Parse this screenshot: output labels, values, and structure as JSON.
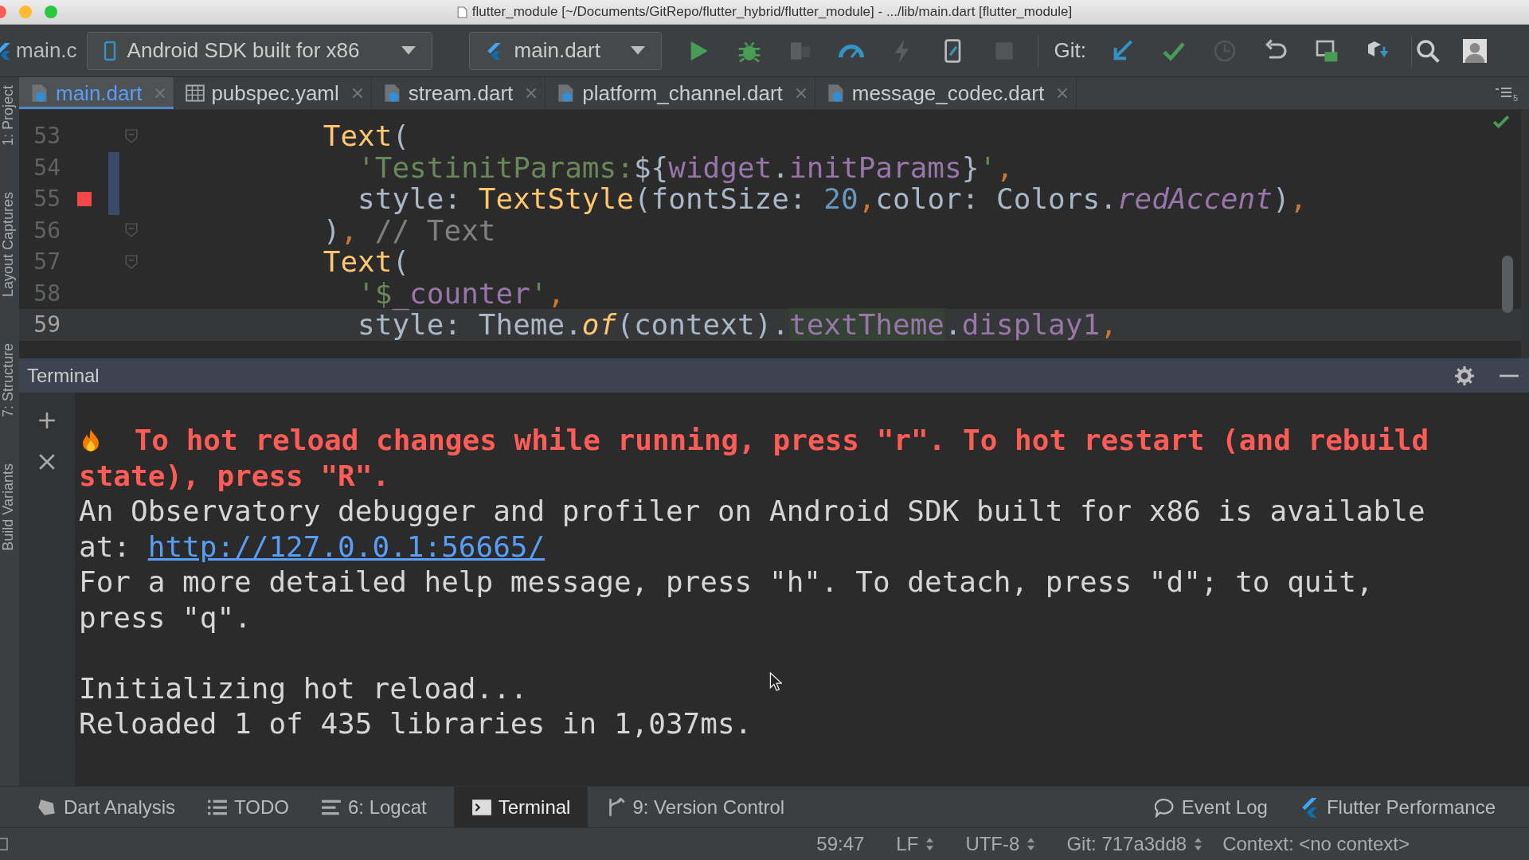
{
  "window": {
    "title": "flutter_module [~/Documents/GitRepo/flutter_hybrid/flutter_module] - .../lib/main.dart [flutter_module]"
  },
  "toolbar": {
    "project_tab": "main.c",
    "device": "Android SDK built for x86",
    "run_config": "main.dart",
    "actions": [
      {
        "kind": "run",
        "disabled": false
      },
      {
        "kind": "debug",
        "disabled": false
      },
      {
        "kind": "attach",
        "disabled": true
      },
      {
        "kind": "profile",
        "disabled": false
      },
      {
        "kind": "hot-reload",
        "disabled": true
      },
      {
        "kind": "device-file",
        "disabled": false
      },
      {
        "kind": "stop",
        "disabled": true
      }
    ],
    "git_label": "Git:",
    "git_actions": [
      {
        "kind": "update",
        "disabled": false
      },
      {
        "kind": "commit",
        "disabled": false
      },
      {
        "kind": "history",
        "disabled": true
      },
      {
        "kind": "revert",
        "disabled": false
      },
      {
        "kind": "screen",
        "disabled": false
      },
      {
        "kind": "boxes",
        "disabled": false
      }
    ]
  },
  "side_panels": [
    "1: Project",
    "Layout Captures",
    "7: Structure",
    "Build Variants"
  ],
  "editor_tabs": [
    {
      "label": "main.dart",
      "selected": true,
      "kind": "dart"
    },
    {
      "label": "pubspec.yaml",
      "selected": false,
      "kind": "yaml"
    },
    {
      "label": "stream.dart",
      "selected": false,
      "kind": "dart"
    },
    {
      "label": "platform_channel.dart",
      "selected": false,
      "kind": "dart"
    },
    {
      "label": "message_codec.dart",
      "selected": false,
      "kind": "dart"
    }
  ],
  "tab_overflow_count": "5",
  "code_lines": [
    {
      "number": "53",
      "breakpoint": false,
      "fold": true,
      "changed": false,
      "current": false,
      "tokens": [
        {
          "kind": "type",
          "text": "          Text"
        },
        {
          "kind": "plain",
          "text": "("
        }
      ]
    },
    {
      "number": "54",
      "breakpoint": false,
      "fold": false,
      "changed": true,
      "current": false,
      "tokens": [
        {
          "kind": "string",
          "text": "            'TestinitParams:"
        },
        {
          "kind": "plain",
          "text": "${"
        },
        {
          "kind": "field",
          "text": "widget"
        },
        {
          "kind": "plain",
          "text": "."
        },
        {
          "kind": "field",
          "text": "initParams"
        },
        {
          "kind": "plain",
          "text": "}"
        },
        {
          "kind": "string",
          "text": "'"
        },
        {
          "kind": "punct",
          "text": ","
        }
      ]
    },
    {
      "number": "55",
      "breakpoint": true,
      "fold": false,
      "changed": true,
      "current": false,
      "tokens": [
        {
          "kind": "plain",
          "text": "            style: "
        },
        {
          "kind": "type",
          "text": "TextStyle"
        },
        {
          "kind": "plain",
          "text": "(fontSize: "
        },
        {
          "kind": "number",
          "text": "20"
        },
        {
          "kind": "punct",
          "text": ","
        },
        {
          "kind": "plain",
          "text": "color: Colors."
        },
        {
          "kind": "static",
          "text": "redAccent"
        },
        {
          "kind": "plain",
          "text": ")"
        },
        {
          "kind": "punct",
          "text": ","
        }
      ]
    },
    {
      "number": "56",
      "breakpoint": false,
      "fold": true,
      "changed": false,
      "current": false,
      "tokens": [
        {
          "kind": "plain",
          "text": "          )"
        },
        {
          "kind": "punct",
          "text": ","
        },
        {
          "kind": "comment",
          "text": " // Text"
        }
      ]
    },
    {
      "number": "57",
      "breakpoint": false,
      "fold": true,
      "changed": false,
      "current": false,
      "tokens": [
        {
          "kind": "type",
          "text": "          Text"
        },
        {
          "kind": "plain",
          "text": "("
        }
      ]
    },
    {
      "number": "58",
      "breakpoint": false,
      "fold": false,
      "changed": false,
      "current": false,
      "tokens": [
        {
          "kind": "string",
          "text": "            '$"
        },
        {
          "kind": "field",
          "text": "_counter"
        },
        {
          "kind": "string",
          "text": "'"
        },
        {
          "kind": "punct",
          "text": ","
        }
      ]
    },
    {
      "number": "59",
      "breakpoint": false,
      "fold": false,
      "changed": false,
      "current": true,
      "tokens": [
        {
          "kind": "plain",
          "text": "            style: Theme."
        },
        {
          "kind": "method",
          "text": "of"
        },
        {
          "kind": "plain",
          "text": "(context)."
        },
        {
          "kind": "field-hl",
          "text": "textTheme"
        },
        {
          "kind": "plain",
          "text": "."
        },
        {
          "kind": "field",
          "text": "display1"
        },
        {
          "kind": "punct",
          "text": ","
        }
      ]
    }
  ],
  "terminal": {
    "title": "Terminal",
    "lines": [
      {
        "kind": "warning-start",
        "blank_line_before": false,
        "text": "To hot reload changes while running, press \"r\". To hot restart (and rebuild"
      },
      {
        "kind": "warning",
        "blank_line_before": false,
        "text": "state), press \"R\"."
      },
      {
        "kind": "info",
        "blank_line_before": false,
        "text": "An Observatory debugger and profiler on Android SDK built for x86 is available at: ",
        "link": "http://127.0.0.1:56665/"
      },
      {
        "kind": "info",
        "blank_line_before": false,
        "text": "For a more detailed help message, press \"h\". To detach, press \"d\"; to quit, press \"q\"."
      },
      {
        "kind": "info",
        "blank_line_before": true,
        "text": "Initializing hot reload..."
      },
      {
        "kind": "info",
        "blank_line_before": false,
        "text": "Reloaded 1 of 435 libraries in 1,037ms."
      }
    ]
  },
  "tool_windows_left": [
    {
      "label": "Dart Analysis",
      "kind": "dart",
      "selected": false
    },
    {
      "label": "TODO",
      "kind": "list",
      "selected": false
    },
    {
      "label": "6: Logcat",
      "kind": "lines",
      "selected": false
    },
    {
      "label": "Terminal",
      "kind": "terminal",
      "selected": true
    },
    {
      "label": "9: Version Control",
      "kind": "branch",
      "selected": false
    }
  ],
  "tool_windows_right": [
    {
      "label": "Event Log",
      "kind": "bubble",
      "selected": false
    },
    {
      "label": "Flutter Performance",
      "kind": "flutter",
      "selected": false
    }
  ],
  "status_bar": {
    "position": "59:47",
    "line_separator": "LF",
    "encoding": "UTF-8",
    "git_branch": "Git: 717a3dd8",
    "context": "Context: <no context>"
  }
}
